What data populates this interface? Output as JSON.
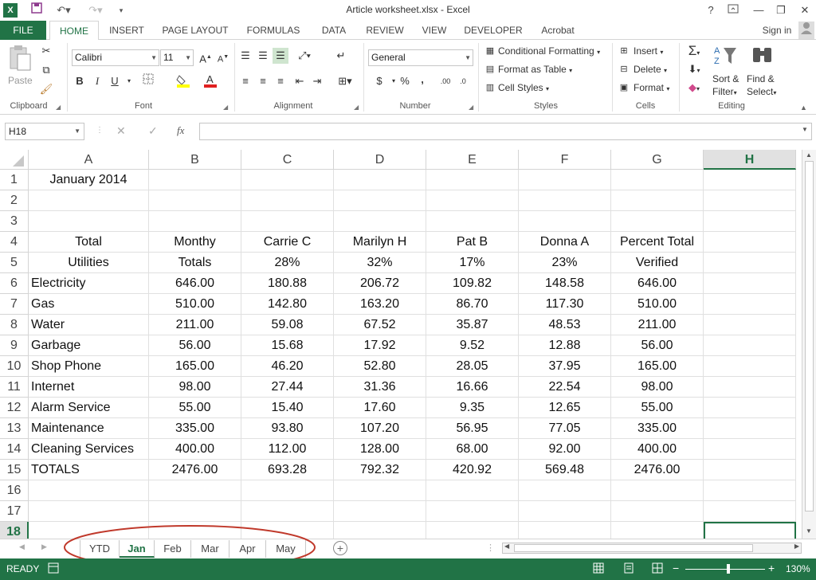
{
  "window": {
    "title": "Article worksheet.xlsx - Excel"
  },
  "titlebar": {
    "help": "?",
    "minimize": "—",
    "restore": "❐",
    "close": "✕"
  },
  "ribbon_tabs": [
    "FILE",
    "HOME",
    "INSERT",
    "PAGE LAYOUT",
    "FORMULAS",
    "DATA",
    "REVIEW",
    "VIEW",
    "DEVELOPER",
    "Acrobat"
  ],
  "user": {
    "sign_in": "Sign in"
  },
  "clipboard": {
    "paste": "Paste",
    "group": "Clipboard"
  },
  "font": {
    "name": "Calibri",
    "size": "11",
    "bold": "B",
    "italic": "I",
    "underline": "U",
    "group": "Font"
  },
  "alignment": {
    "group": "Alignment"
  },
  "number": {
    "format": "General",
    "currency": "$",
    "percent": "%",
    "comma": ",",
    "group": "Number"
  },
  "styles": {
    "conditional": "Conditional Formatting",
    "format_table": "Format as Table",
    "cell_styles": "Cell Styles",
    "group": "Styles"
  },
  "cells": {
    "insert": "Insert",
    "delete": "Delete",
    "format": "Format",
    "group": "Cells"
  },
  "editing": {
    "sort_filter_1": "Sort &",
    "sort_filter_2": "Filter",
    "find_select_1": "Find &",
    "find_select_2": "Select",
    "group": "Editing"
  },
  "formula_bar": {
    "name_box": "H18",
    "fx": "fx",
    "value": ""
  },
  "columns": [
    "A",
    "B",
    "C",
    "D",
    "E",
    "F",
    "G",
    "H"
  ],
  "rows": [
    [
      "January 2014",
      "",
      "",
      "",
      "",
      "",
      "",
      ""
    ],
    [
      "",
      "",
      "",
      "",
      "",
      "",
      "",
      ""
    ],
    [
      "",
      "",
      "",
      "",
      "",
      "",
      "",
      ""
    ],
    [
      "Total",
      "Monthy",
      "Carrie C",
      "Marilyn H",
      "Pat B",
      "Donna A",
      "Percent Total",
      ""
    ],
    [
      "Utilities",
      "Totals",
      "28%",
      "32%",
      "17%",
      "23%",
      "Verified",
      ""
    ],
    [
      "Electricity",
      "646.00",
      "180.88",
      "206.72",
      "109.82",
      "148.58",
      "646.00",
      ""
    ],
    [
      "Gas",
      "510.00",
      "142.80",
      "163.20",
      "86.70",
      "117.30",
      "510.00",
      ""
    ],
    [
      "Water",
      "211.00",
      "59.08",
      "67.52",
      "35.87",
      "48.53",
      "211.00",
      ""
    ],
    [
      "Garbage",
      "56.00",
      "15.68",
      "17.92",
      "9.52",
      "12.88",
      "56.00",
      ""
    ],
    [
      "Shop Phone",
      "165.00",
      "46.20",
      "52.80",
      "28.05",
      "37.95",
      "165.00",
      ""
    ],
    [
      "Internet",
      "98.00",
      "27.44",
      "31.36",
      "16.66",
      "22.54",
      "98.00",
      ""
    ],
    [
      "Alarm Service",
      "55.00",
      "15.40",
      "17.60",
      "9.35",
      "12.65",
      "55.00",
      ""
    ],
    [
      "Maintenance",
      "335.00",
      "93.80",
      "107.20",
      "56.95",
      "77.05",
      "335.00",
      ""
    ],
    [
      "Cleaning Services",
      "400.00",
      "112.00",
      "128.00",
      "68.00",
      "92.00",
      "400.00",
      ""
    ],
    [
      "TOTALS",
      "2476.00",
      "693.28",
      "792.32",
      "420.92",
      "569.48",
      "2476.00",
      ""
    ],
    [
      "",
      "",
      "",
      "",
      "",
      "",
      "",
      ""
    ],
    [
      "",
      "",
      "",
      "",
      "",
      "",
      "",
      ""
    ],
    [
      "",
      "",
      "",
      "",
      "",
      "",
      "",
      ""
    ]
  ],
  "sheet_tabs": [
    "YTD",
    "Jan",
    "Feb",
    "Mar",
    "Apr",
    "May"
  ],
  "active_sheet": "Jan",
  "status": {
    "mode": "READY",
    "zoom": "130%"
  },
  "colors": {
    "accent": "#217346",
    "annotation": "#c0392b"
  }
}
